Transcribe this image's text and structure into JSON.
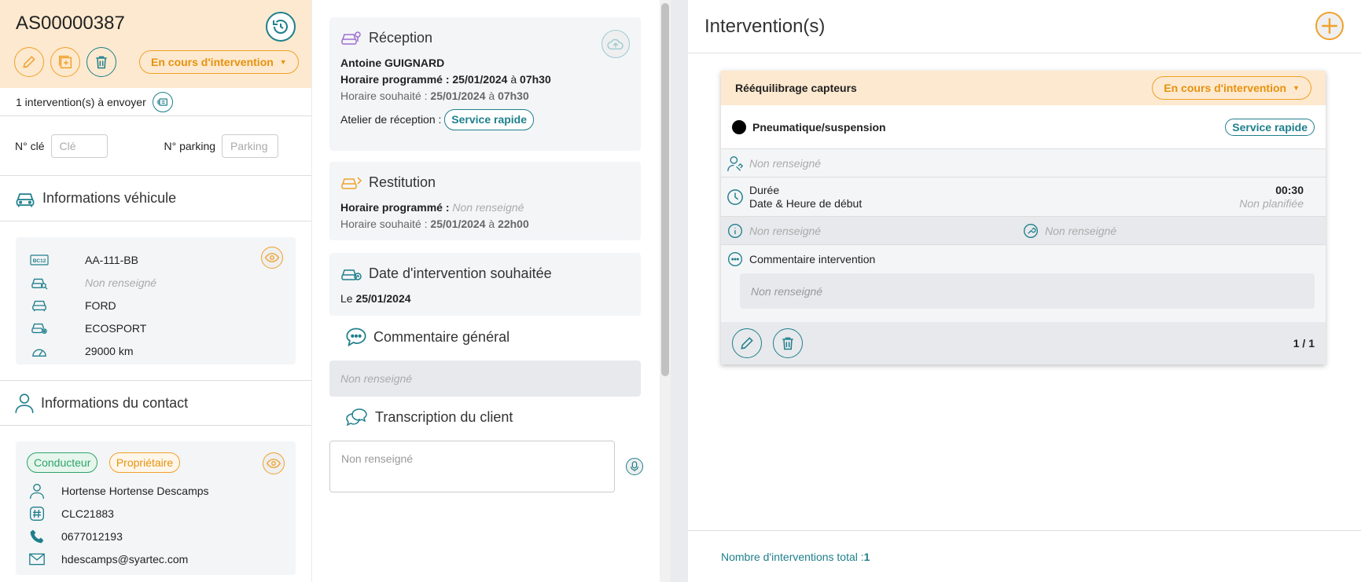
{
  "reception_order": {
    "reference": "AS00000387",
    "status": "En cours d'intervention",
    "to_send": "1 intervention(s) à envoyer",
    "key_label": "N° clé",
    "key_placeholder": "Clé",
    "parking_label": "N° parking",
    "parking_placeholder": "Parking"
  },
  "vehicle": {
    "section_title": "Informations véhicule",
    "plate": "AA-111-BB",
    "vin": "Non renseigné",
    "brand": "FORD",
    "model": "ECOSPORT",
    "mileage": "29000 km"
  },
  "contact": {
    "section_title": "Informations du contact",
    "tag_driver": "Conducteur",
    "tag_owner": "Propriétaire",
    "name": "Hortense Hortense Descamps",
    "client_id": "CLC21883",
    "phone": "0677012193",
    "email": "hdescamps@syartec.com"
  },
  "reception": {
    "title": "Réception",
    "person": "Antoine GUIGNARD",
    "scheduled_label": "Horaire programmé : ",
    "scheduled_date": "25/01/2024",
    "at": " à ",
    "scheduled_time": "07h30",
    "wished_label": "Horaire souhaité : ",
    "wished_date": "25/01/2024",
    "wished_time": "07h30",
    "workshop_label": "Atelier de réception : ",
    "workshop": "Service rapide"
  },
  "restitution": {
    "title": "Restitution",
    "scheduled_label": "Horaire programmé : ",
    "scheduled_value": "Non renseigné",
    "wished_label": "Horaire souhaité : ",
    "wished_date": "25/01/2024",
    "at": " à ",
    "wished_time": "22h00"
  },
  "wished_date": {
    "title": "Date d'intervention souhaitée",
    "prefix": "Le ",
    "date": "25/01/2024"
  },
  "general_comment": {
    "title": "Commentaire général",
    "value": "Non renseigné"
  },
  "transcript": {
    "title": "Transcription du client",
    "placeholder": "Non renseigné"
  },
  "interventions": {
    "title": "Intervention(s)",
    "card": {
      "name": "Rééquilibrage capteurs",
      "status": "En cours d'intervention",
      "type": "Pneumatique/suspension",
      "workshop": "Service rapide",
      "technician": "Non renseigné",
      "duration_label": "Durée",
      "duration_value": "00:30",
      "start_label": "Date & Heure de début",
      "start_value": "Non planifiée",
      "info": "Non renseigné",
      "tool": "Non renseigné",
      "comment_label": "Commentaire intervention",
      "comment_value": "Non renseigné",
      "pagination": "1 / 1"
    },
    "total_label": "Nombre d'interventions total : ",
    "total_value": "1"
  },
  "colors": {
    "accent_teal": "#1e7f8c",
    "accent_orange": "#f0a12a",
    "header_bg": "#fde9cf"
  }
}
